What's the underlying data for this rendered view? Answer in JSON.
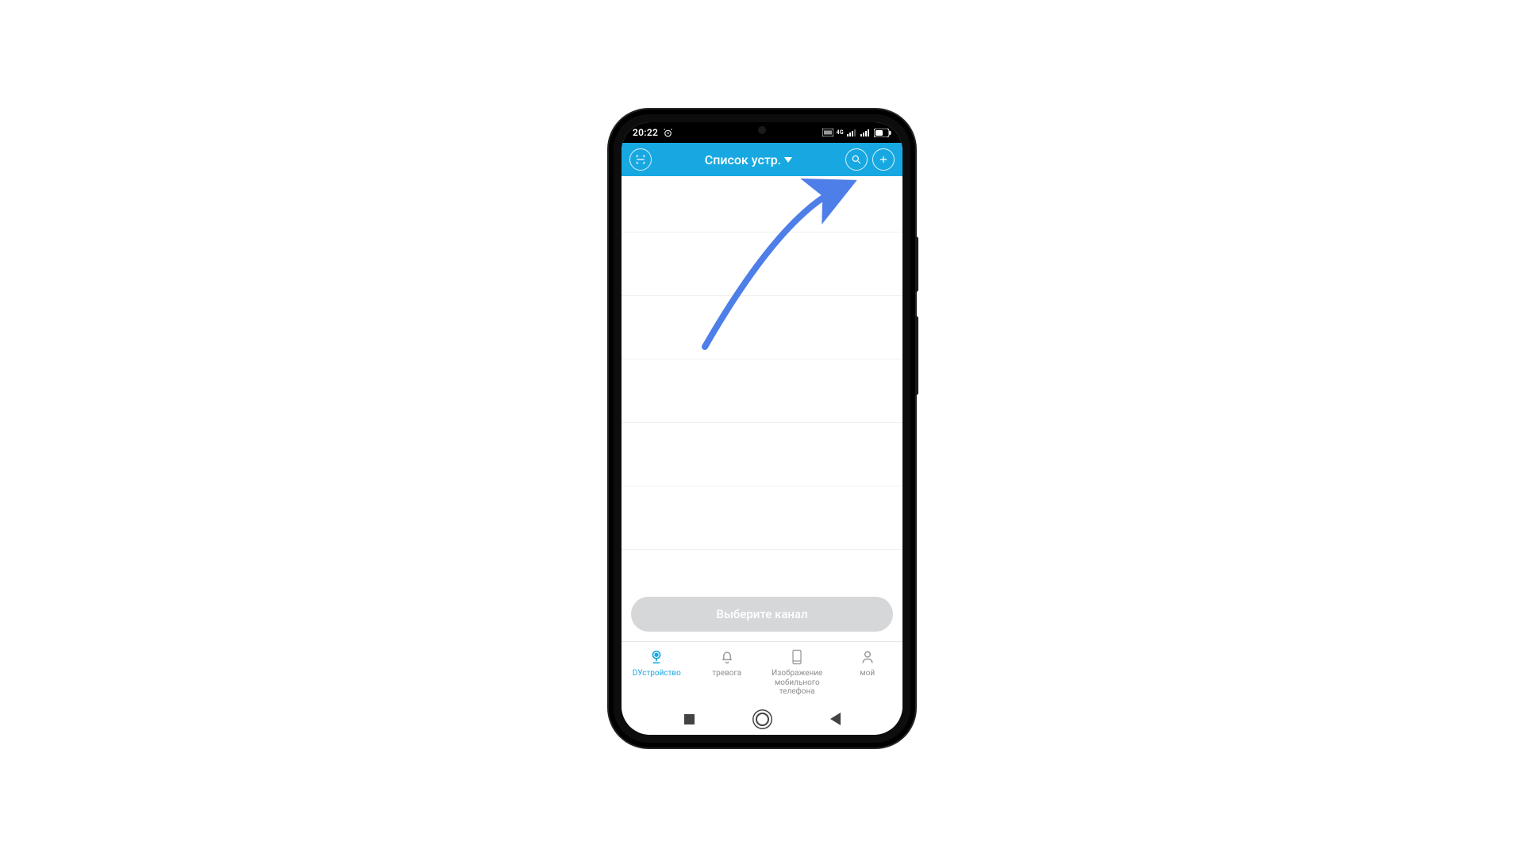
{
  "statusbar": {
    "time": "20:22",
    "network_label": "4G"
  },
  "header": {
    "title": "Список устр."
  },
  "content": {
    "channel_button": "Выберите канал"
  },
  "bottomnav": {
    "items": [
      {
        "label": "DУстройство"
      },
      {
        "label": "тревога"
      },
      {
        "label": "Изображение мобильного телефона"
      },
      {
        "label": "мой"
      }
    ]
  },
  "colors": {
    "accent": "#18a8e1",
    "annotation": "#4e7ee8"
  }
}
